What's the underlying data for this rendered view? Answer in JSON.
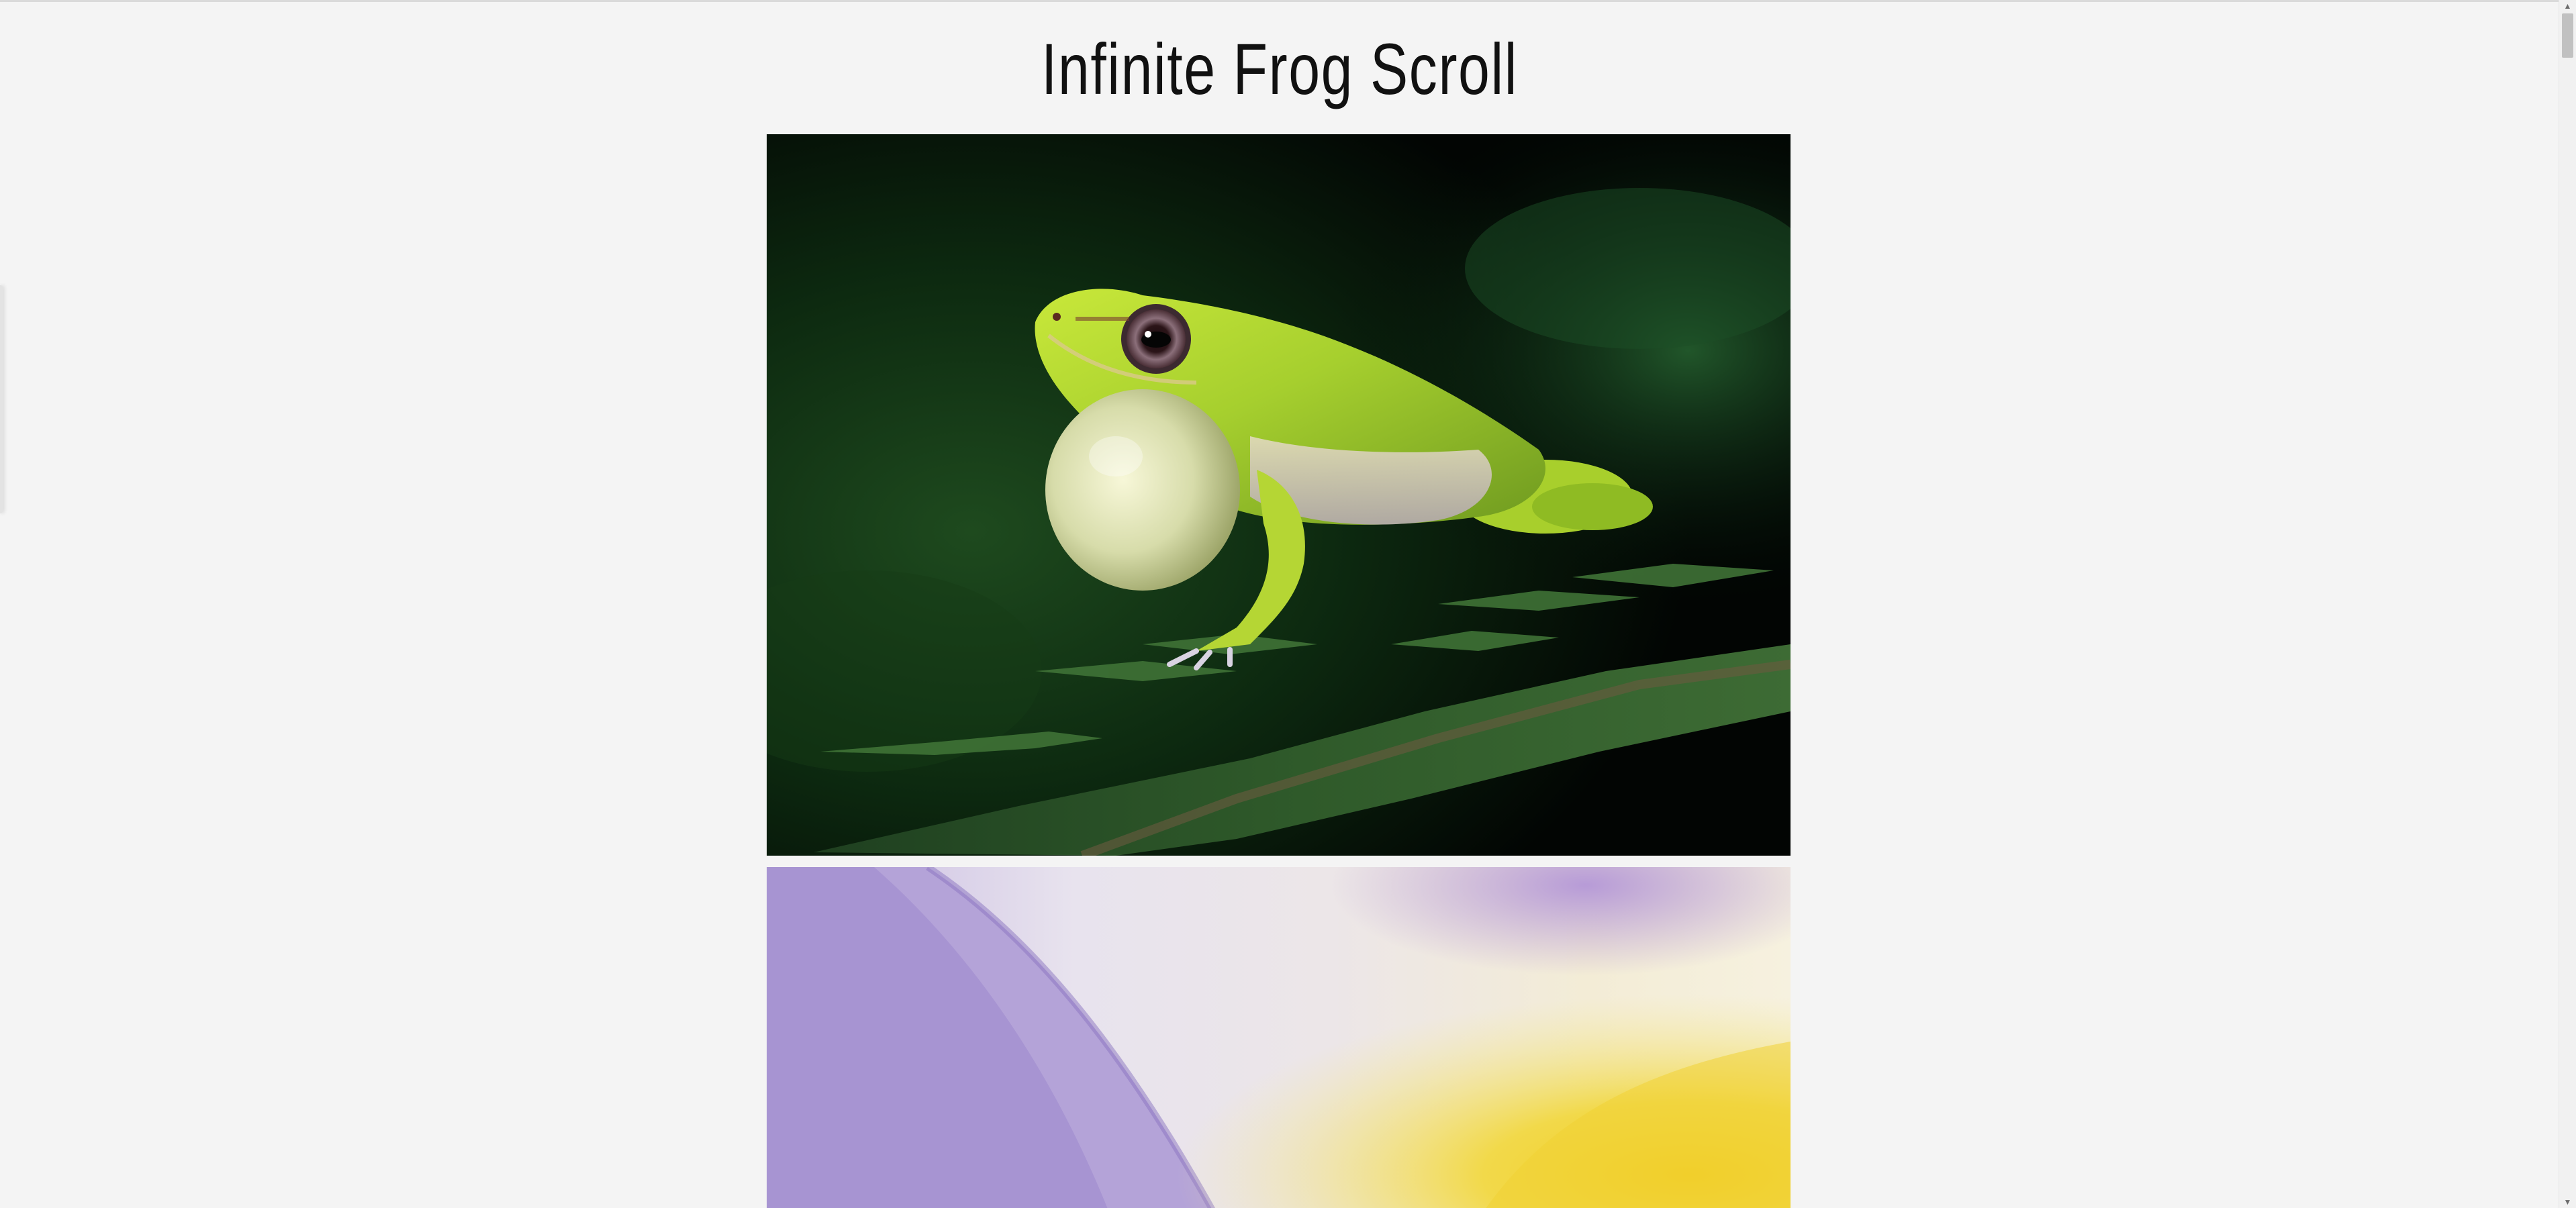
{
  "page": {
    "title": "Infinite Frog Scroll"
  },
  "feed": {
    "items": [
      {
        "icon": "frog-photo",
        "subject": "green tree frog on fern"
      },
      {
        "icon": "flower-photo",
        "subject": "purple and yellow flower close-up"
      }
    ]
  },
  "colors": {
    "background": "#f4f4f4",
    "title": "#111111",
    "scroll_thumb": "#c1c1c1"
  },
  "scrollbar": {
    "up_arrow": "▲",
    "down_arrow": "▼"
  }
}
